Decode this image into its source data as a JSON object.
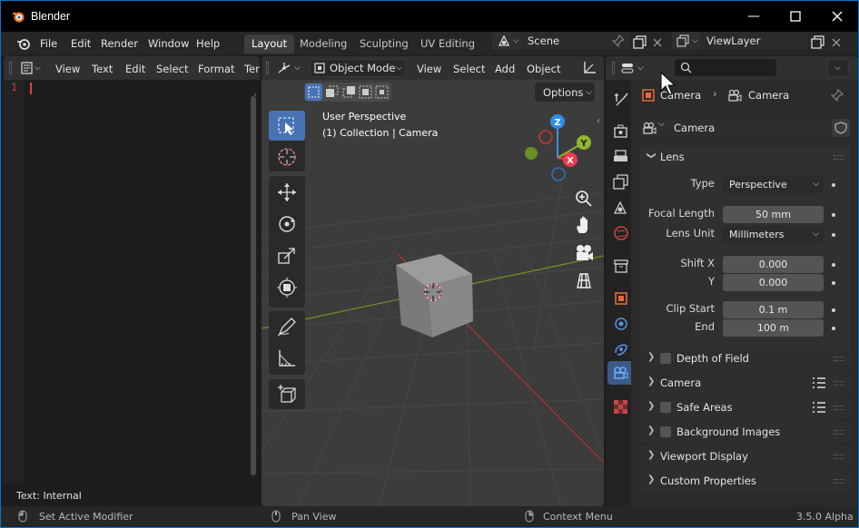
{
  "window": {
    "title": "Blender"
  },
  "topbar": {
    "menus": [
      "File",
      "Edit",
      "Render",
      "Window",
      "Help"
    ],
    "workspaces": [
      "Layout",
      "Modeling",
      "Sculpting",
      "UV Editing"
    ],
    "active_workspace": "Layout",
    "scene_name": "Scene",
    "view_layer_name": "ViewLayer"
  },
  "text_editor": {
    "menus": [
      "View",
      "Text",
      "Edit",
      "Select",
      "Format",
      "Ter"
    ],
    "line_number": "1",
    "footer": "Text: Internal"
  },
  "viewport": {
    "mode": "Object Mode",
    "menus": [
      "View",
      "Select",
      "Add",
      "Object"
    ],
    "options_label": "Options",
    "perspective_label": "User Perspective",
    "collection_label": "(1) Collection | Camera",
    "gizmo_axes": {
      "x": "X",
      "y": "Y",
      "z": "Z"
    }
  },
  "properties": {
    "breadcrumb": [
      "Camera",
      "Camera"
    ],
    "datablock_name": "Camera",
    "lens_panel": {
      "title": "Lens",
      "type_label": "Type",
      "type_value": "Perspective",
      "focal_length_label": "Focal Length",
      "focal_length_value": "50 mm",
      "lens_unit_label": "Lens Unit",
      "lens_unit_value": "Millimeters",
      "shift_x_label": "Shift X",
      "shift_x_value": "0.000",
      "shift_y_label": "Y",
      "shift_y_value": "0.000",
      "clip_start_label": "Clip Start",
      "clip_start_value": "0.1 m",
      "clip_end_label": "End",
      "clip_end_value": "100 m"
    },
    "collapsed_panels": [
      "Depth of Field",
      "Camera",
      "Safe Areas",
      "Background Images",
      "Viewport Display",
      "Custom Properties"
    ]
  },
  "statusbar": {
    "left": "Set Active Modifier",
    "middle": "Pan View",
    "right": "Context Menu",
    "version": "3.5.0 Alpha"
  },
  "colors": {
    "accent_blue": "#4772b3",
    "x_axis": "#f03a4f",
    "y_axis": "#8fb52b",
    "z_axis": "#3a8fe6",
    "window_border": "#0b72c9"
  }
}
